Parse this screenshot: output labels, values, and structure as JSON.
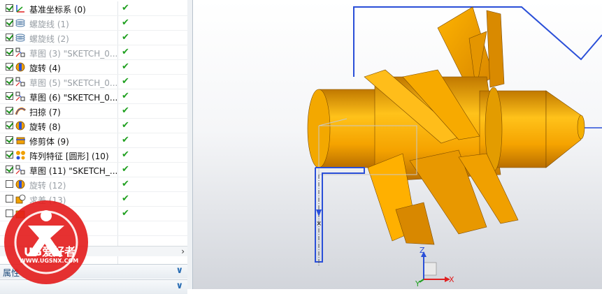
{
  "tree": [
    {
      "label": "基准坐标系 (0)",
      "icon": "datum-csys-icon",
      "checked": true,
      "dim": false,
      "ok": true
    },
    {
      "label": "螺旋线 (1)",
      "icon": "helix-icon",
      "checked": true,
      "dim": true,
      "ok": true
    },
    {
      "label": "螺旋线 (2)",
      "icon": "helix-icon",
      "checked": true,
      "dim": true,
      "ok": true
    },
    {
      "label": "草图 (3) \"SKETCH_0...",
      "icon": "sketch-icon",
      "checked": true,
      "dim": true,
      "ok": true
    },
    {
      "label": "旋转 (4)",
      "icon": "revolve-icon",
      "checked": true,
      "dim": false,
      "ok": true
    },
    {
      "label": "草图 (5) \"SKETCH_0...",
      "icon": "sketch-icon",
      "checked": true,
      "dim": true,
      "ok": true
    },
    {
      "label": "草图 (6) \"SKETCH_0...",
      "icon": "sketch-icon",
      "checked": true,
      "dim": false,
      "ok": true
    },
    {
      "label": "扫掠 (7)",
      "icon": "swept-icon",
      "checked": true,
      "dim": false,
      "ok": true
    },
    {
      "label": "旋转 (8)",
      "icon": "revolve-icon",
      "checked": true,
      "dim": false,
      "ok": true
    },
    {
      "label": "修剪体 (9)",
      "icon": "trim-body-icon",
      "checked": true,
      "dim": false,
      "ok": true
    },
    {
      "label": "阵列特征 [圆形] (10)",
      "icon": "pattern-feature-icon",
      "checked": true,
      "dim": false,
      "ok": true
    },
    {
      "label": "草图 (11) \"SKETCH_...",
      "icon": "sketch-icon",
      "checked": true,
      "dim": false,
      "ok": true
    },
    {
      "label": "旋转 (12)",
      "icon": "revolve-icon",
      "checked": false,
      "dim": true,
      "ok": true
    },
    {
      "label": "求差 (13)",
      "icon": "subtract-icon",
      "checked": false,
      "dim": true,
      "ok": true
    },
    {
      "label": "",
      "icon": "feature-icon",
      "checked": false,
      "dim": true,
      "ok": true
    }
  ],
  "scroll_arrow": "›",
  "panels": [
    {
      "title": "属性",
      "chevron": "∨"
    },
    {
      "title": "",
      "chevron": "∨"
    }
  ],
  "triad": {
    "z": "Z",
    "y": "Y",
    "x": "X"
  },
  "watermark": {
    "brand": "UG爱好者",
    "url": "WWW.UGSNX.COM"
  },
  "colors": {
    "part": "#f0a000",
    "edge": "#7a4a00",
    "wire": "#2a4fd8",
    "check": "#20a020"
  }
}
